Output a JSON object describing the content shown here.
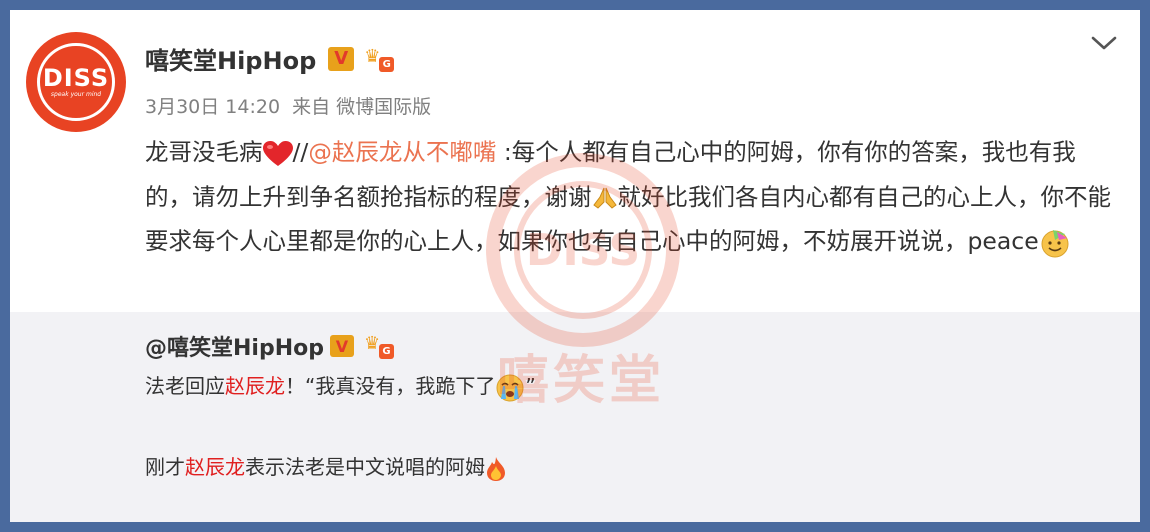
{
  "post": {
    "avatar": {
      "logo_text": "DISS",
      "logo_subtext": "speak your mind"
    },
    "username": "嘻笑堂HipHop",
    "verified_badge": "V",
    "level_badge": "G",
    "timestamp": "3月30日 14:20",
    "source_prefix": "来自",
    "source": "微博国际版",
    "body": {
      "part1": "龙哥没毛病",
      "part2": "//",
      "mention": "@赵辰龙从不嘟嘴",
      "part3": " :每个人都有自己心中的阿姆，你有你的答案，我也有我的，请勿上升到争名额抢指标的程度，谢谢",
      "part4": "就好比我们各自内心都有自己的心上人，你不能要求每个人心里都是你的心上人，如果你也有自己心中的阿姆，不妨展开说说，peace"
    }
  },
  "repost": {
    "username": "@嘻笑堂HipHop",
    "verified_badge": "V",
    "level_badge": "G",
    "line1": {
      "before": "法老回应",
      "name": "赵辰龙",
      "after": "！“我真没有，我跪下了",
      "close": "”"
    },
    "line2": {
      "before": "刚才",
      "name": "赵辰龙",
      "after": "表示法老是中文说唱的阿姆"
    }
  },
  "watermark": {
    "logo_text": "DISS",
    "text": "嘻笑堂"
  },
  "colors": {
    "accent": "#e84323",
    "mention": "#eb7350",
    "name_red": "#e02020",
    "repost_bg": "#f2f2f5",
    "frame": "#4a6a9e"
  }
}
